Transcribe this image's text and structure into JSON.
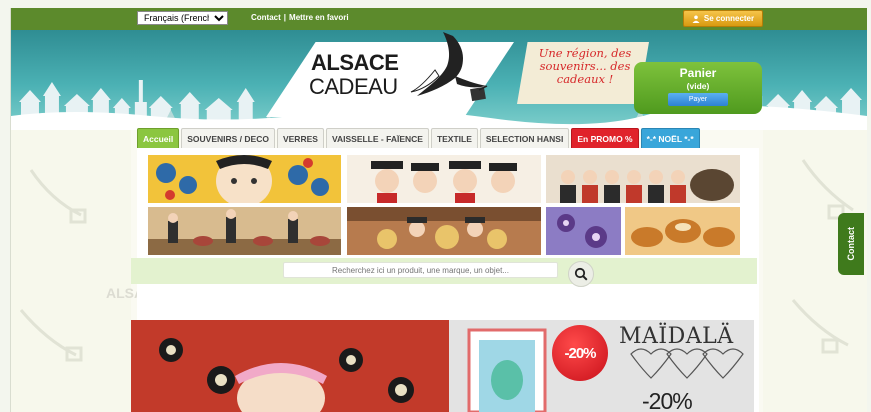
{
  "topbar": {
    "language": "Français (French)",
    "links": [
      "Contact",
      "|",
      "Mettre en favori"
    ],
    "login_label": "Se connecter"
  },
  "logo": {
    "line1": "ALSACE",
    "line2": "CADEAU"
  },
  "slogan": "Une région, des souvenirs... des cadeaux !",
  "cart": {
    "title": "Panier",
    "status": "(vide)",
    "pay_label": "Payer"
  },
  "nav": {
    "items": [
      {
        "label": "Accueil",
        "style": "active"
      },
      {
        "label": "SOUVENIRS / DECO",
        "style": "normal"
      },
      {
        "label": "VERRES",
        "style": "normal"
      },
      {
        "label": "VAISSELLE - FAÏENCE",
        "style": "normal"
      },
      {
        "label": "TEXTILE",
        "style": "normal"
      },
      {
        "label": "SELECTION HANSI",
        "style": "normal"
      },
      {
        "label": "En PROMO %",
        "style": "promo"
      },
      {
        "label": "*-* NOËL *-*",
        "style": "noel"
      }
    ]
  },
  "search": {
    "placeholder": "Recherchez ici un produit, une marque, un objet..."
  },
  "side_tab": {
    "label": "Contact"
  },
  "promo": {
    "badge": "-20%",
    "brand": "MAÏDALÄ",
    "discount": "-20%"
  },
  "colors": {
    "topbar": "#5c8a2c",
    "accent_green": "#8bc640",
    "promo_red": "#e0232b",
    "noel_blue": "#39a6da",
    "cart_green": "#5da224"
  }
}
